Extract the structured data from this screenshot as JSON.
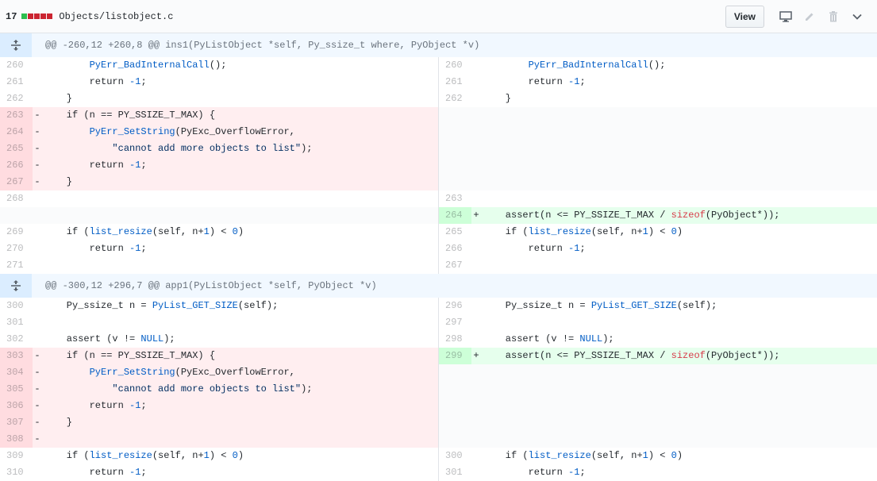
{
  "header": {
    "count": "17",
    "path": "Objects/listobject.c",
    "view_label": "View",
    "diffstat_colors": [
      "#2cbe4e",
      "#cb2431",
      "#cb2431",
      "#cb2431",
      "#cb2431"
    ],
    "icons": [
      "desktop-icon",
      "pencil-icon",
      "trash-icon",
      "chevron-down-icon"
    ]
  },
  "hunks": [
    {
      "text": "@@ -260,12 +260,8 @@ ins1(PyListObject *self, Py_ssize_t where, PyObject *v)"
    },
    {
      "text": "@@ -300,12 +296,7 @@ app1(PyListObject *self, PyObject *v)"
    }
  ],
  "rows": [
    {
      "type": "ctx",
      "ln": "260",
      "rn": "260",
      "code": "        PyErr_BadInternalCall();"
    },
    {
      "type": "ctx",
      "ln": "261",
      "rn": "261",
      "code": "        return -1;"
    },
    {
      "type": "ctx",
      "ln": "262",
      "rn": "262",
      "code": "    }"
    },
    {
      "type": "del",
      "ln": "263",
      "code": "    if (n == PY_SSIZE_T_MAX) {"
    },
    {
      "type": "del",
      "ln": "264",
      "code": "        PyErr_SetString(PyExc_OverflowError,"
    },
    {
      "type": "del",
      "ln": "265",
      "code": "            \"cannot add more objects to list\");"
    },
    {
      "type": "del",
      "ln": "266",
      "code": "        return -1;"
    },
    {
      "type": "del",
      "ln": "267",
      "code": "    }"
    },
    {
      "type": "ctx",
      "ln": "268",
      "rn": "263",
      "code": ""
    },
    {
      "type": "add",
      "rn": "264",
      "code": "    assert(n <= PY_SSIZE_T_MAX / sizeof(PyObject*));"
    },
    {
      "type": "ctx",
      "ln": "269",
      "rn": "265",
      "code": "    if (list_resize(self, n+1) < 0)"
    },
    {
      "type": "ctx",
      "ln": "270",
      "rn": "266",
      "code": "        return -1;"
    },
    {
      "type": "ctx",
      "ln": "271",
      "rn": "267",
      "code": ""
    },
    {
      "type": "ctx",
      "ln": "300",
      "rn": "296",
      "code": "    Py_ssize_t n = PyList_GET_SIZE(self);"
    },
    {
      "type": "ctx",
      "ln": "301",
      "rn": "297",
      "code": ""
    },
    {
      "type": "ctx",
      "ln": "302",
      "rn": "298",
      "code": "    assert (v != NULL);"
    },
    {
      "type": "mod",
      "ln": "303",
      "rn": "299",
      "lcode": "    if (n == PY_SSIZE_T_MAX) {",
      "rcode": "    assert(n <= PY_SSIZE_T_MAX / sizeof(PyObject*));"
    },
    {
      "type": "del",
      "ln": "304",
      "code": "        PyErr_SetString(PyExc_OverflowError,"
    },
    {
      "type": "del",
      "ln": "305",
      "code": "            \"cannot add more objects to list\");"
    },
    {
      "type": "del",
      "ln": "306",
      "code": "        return -1;"
    },
    {
      "type": "del",
      "ln": "307",
      "code": "    }"
    },
    {
      "type": "del",
      "ln": "308",
      "code": ""
    },
    {
      "type": "ctx",
      "ln": "309",
      "rn": "300",
      "code": "    if (list_resize(self, n+1) < 0)"
    },
    {
      "type": "ctx",
      "ln": "310",
      "rn": "301",
      "code": "        return -1;"
    }
  ]
}
